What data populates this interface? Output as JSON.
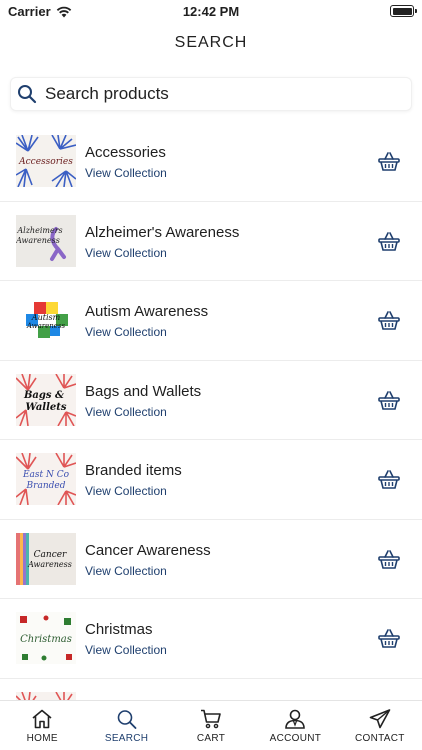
{
  "status_bar": {
    "carrier": "Carrier",
    "time": "12:42 PM"
  },
  "header": {
    "title": "SEARCH"
  },
  "search": {
    "placeholder": "Search products"
  },
  "accent_color": "#1f3f6e",
  "collections": [
    {
      "title": "Accessories",
      "link": "View Collection",
      "thumb_text": "Accessories"
    },
    {
      "title": "Alzheimer's Awareness",
      "link": "View Collection",
      "thumb_text": "Alzheimers Awareness"
    },
    {
      "title": "Autism Awareness",
      "link": "View Collection",
      "thumb_text": "Autism Awareness"
    },
    {
      "title": "Bags and Wallets",
      "link": "View Collection",
      "thumb_text": "Bags & Wallets"
    },
    {
      "title": "Branded items",
      "link": "View Collection",
      "thumb_text": "East N Co Branded"
    },
    {
      "title": "Cancer Awareness",
      "link": "View Collection",
      "thumb_text": "Cancer Awareness"
    },
    {
      "title": "Christmas",
      "link": "View Collection",
      "thumb_text": "Christmas"
    }
  ],
  "tabs": [
    {
      "label": "HOME",
      "icon": "home-icon"
    },
    {
      "label": "SEARCH",
      "icon": "search-icon",
      "active": true
    },
    {
      "label": "CART",
      "icon": "cart-icon"
    },
    {
      "label": "ACCOUNT",
      "icon": "account-icon"
    },
    {
      "label": "CONTACT",
      "icon": "send-icon"
    }
  ]
}
